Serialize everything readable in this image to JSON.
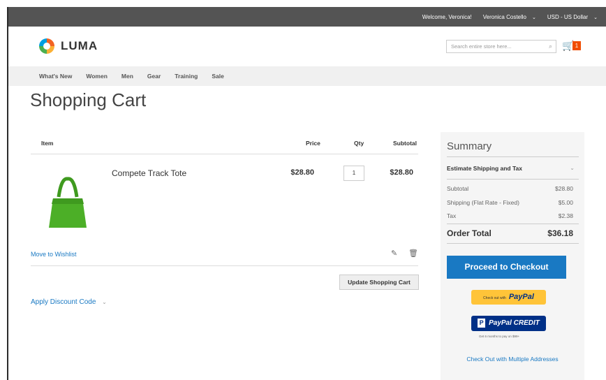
{
  "topbar": {
    "welcome": "Welcome, Veronica!",
    "account": "Veronica Costello",
    "currency": "USD - US Dollar"
  },
  "header": {
    "logo_text": "LUMA",
    "search_placeholder": "Search entire store here...",
    "cart_count": "1"
  },
  "nav": {
    "items": [
      "What's New",
      "Women",
      "Men",
      "Gear",
      "Training",
      "Sale"
    ]
  },
  "page_title": "Shopping Cart",
  "cart": {
    "headers": {
      "item": "Item",
      "price": "Price",
      "qty": "Qty",
      "subtotal": "Subtotal"
    },
    "item": {
      "name": "Compete Track Tote",
      "price": "$28.80",
      "qty": "1",
      "subtotal": "$28.80"
    },
    "move_to_wishlist": "Move to Wishlist",
    "update_label": "Update Shopping Cart",
    "discount_label": "Apply Discount Code"
  },
  "summary": {
    "title": "Summary",
    "estimate_label": "Estimate Shipping and Tax",
    "rows": [
      {
        "label": "Subtotal",
        "value": "$28.80"
      },
      {
        "label": "Shipping (Flat Rate - Fixed)",
        "value": "$5.00"
      },
      {
        "label": "Tax",
        "value": "$2.38"
      }
    ],
    "order_total_label": "Order Total",
    "order_total_value": "$36.18",
    "checkout_label": "Proceed to Checkout",
    "paypal_small": "Check out with",
    "paypal_label": "PayPal",
    "paypal_credit_label": "PayPal CREDIT",
    "credit_note": "Get 6 months to pay on $99+",
    "multi_address": "Check Out with Multiple Addresses"
  },
  "colors": {
    "accent": "#1979c3",
    "cart_badge": "#f04c00",
    "paypal_yellow": "#ffc439",
    "paypal_blue": "#003087",
    "product_green": "#4caf27"
  },
  "icons": [
    "logo-icon",
    "search-icon",
    "cart-icon",
    "edit-icon",
    "trash-icon",
    "chevron-down-icon"
  ]
}
